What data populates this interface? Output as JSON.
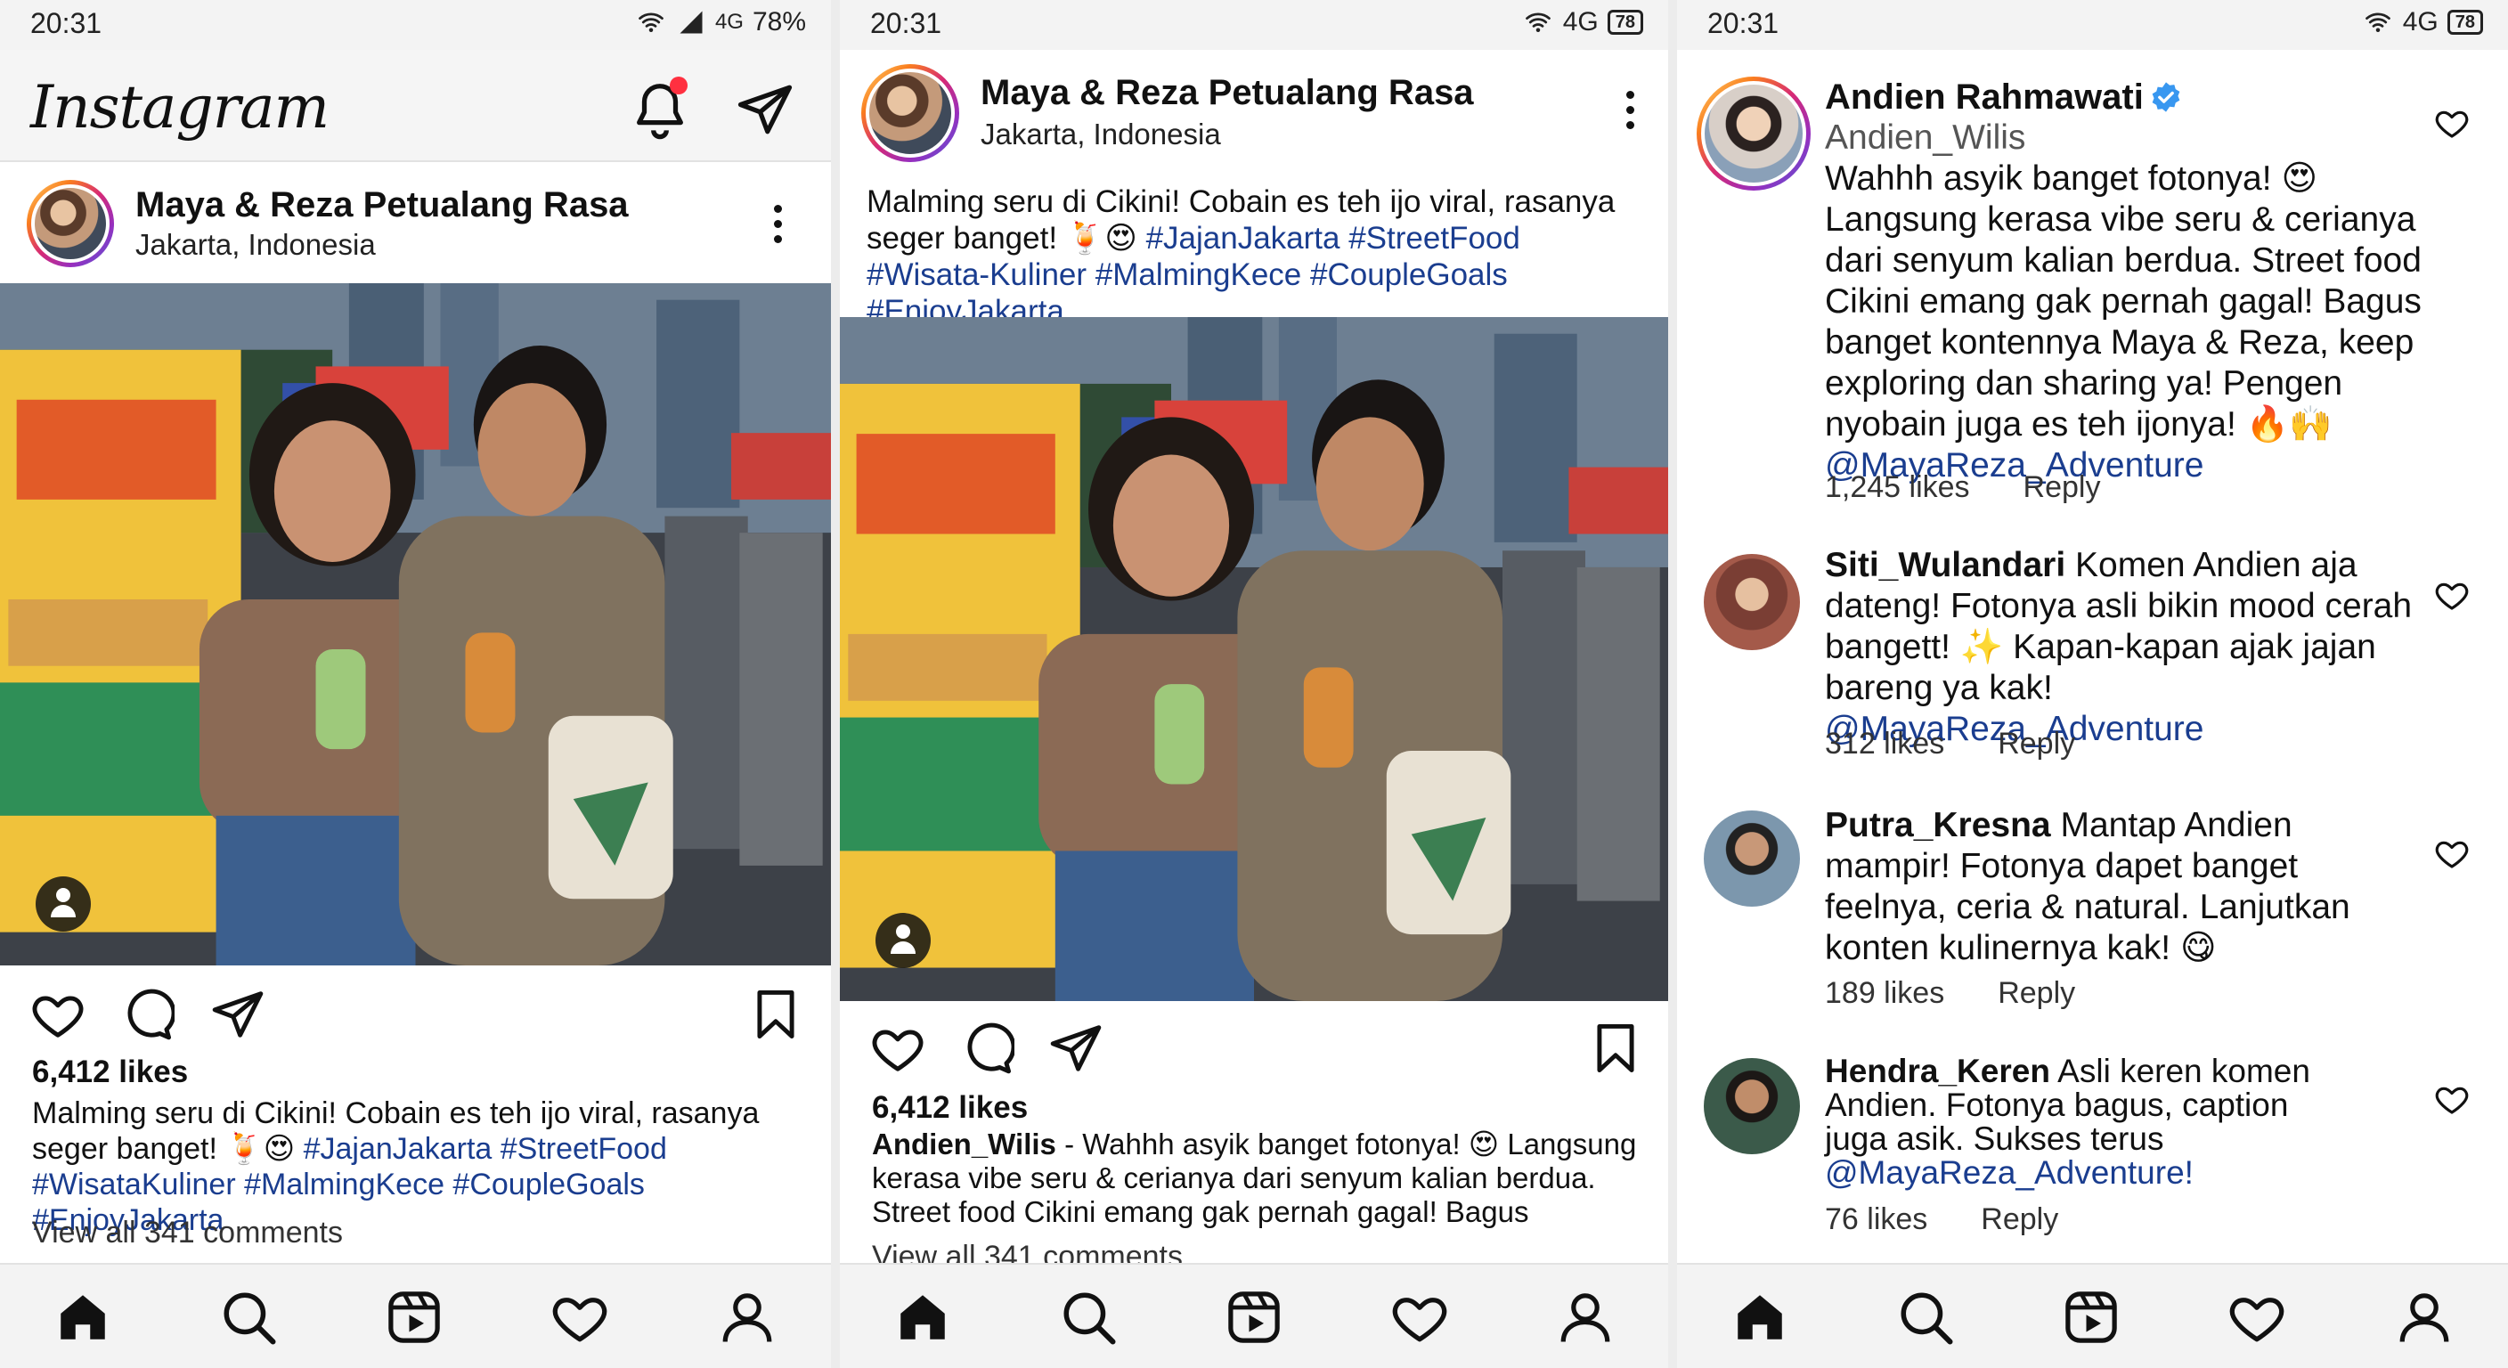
{
  "colors": {
    "accent_link": "#1a3d8f",
    "notification": "#ff3040",
    "verified": "#3897f0"
  },
  "panel1": {
    "status": {
      "time": "20:31",
      "network": "4G",
      "battery": "78%"
    },
    "app_title": "Instagram",
    "post": {
      "account": "Maya & Reza Petualang Rasa",
      "location": "Jakarta, Indonesia",
      "likes": "6,412 likes",
      "caption_text": "Malming seru di Cikini! Cobain es teh ijo viral, rasanya seger banget! 🍹😍 ",
      "caption_tags": "#JajanJakarta #StreetFood #WisataKuliner #MalmingKece #CoupleGoals #EnjoyJakarta",
      "view_all": "View all 341 comments"
    }
  },
  "panel2": {
    "status": {
      "time": "20:31",
      "network": "4G",
      "battery": "78"
    },
    "post": {
      "account": "Maya & Reza Petualang Rasa",
      "location": "Jakarta, Indonesia",
      "caption_text": "Malming seru di Cikini! Cobain es teh ijo viral, rasanya seger banget! 🍹😍 ",
      "caption_tags": "#JajanJakarta #StreetFood #Wisata-Kuliner #MalmingKece #CoupleGoals #EnjoyJakarta",
      "likes": "6,412 likes",
      "comment_user": "Andien_Wilis",
      "comment_text": " - Wahhh asyik banget fotonya! 😍 Langsung kerasa vibe seru & cerianya dari senyum kalian berdua. Street food Cikini emang gak pernah gagal! Bagus",
      "view_all": "View all 341 comments"
    }
  },
  "panel3": {
    "status": {
      "time": "20:31",
      "network": "4G",
      "battery": "78"
    },
    "comments": [
      {
        "name": "Andien Rahmawati",
        "handle": "Andien_Wilis",
        "text": "Wahhh asyik banget fotonya! 😍 Langsung kerasa vibe seru & cerianya dari senyum kalian berdua. Street food Cikini emang gak pernah gagal! Bagus banget kontennya Maya & Reza, keep exploring dan sharing ya! Pengen nyobain juga es teh ijonya! 🔥🙌",
        "mention": "@MayaReza_Adventure",
        "likes": "1,245 likes",
        "reply": "Reply"
      },
      {
        "name": "Siti_Wulandari",
        "text": " Komen Andien aja dateng! Fotonya asli bikin mood cerah bangett! ✨ Kapan-kapan ajak jajan bareng ya kak!",
        "mention": "@MayaReza_Adventure",
        "likes": "312 likes",
        "reply": "Reply"
      },
      {
        "name": "Putra_Kresna",
        "text": " Mantap Andien mampir! Fotonya dapet banget feelnya, ceria & natural. Lanjutkan konten kulinernya kak! 😋",
        "likes": "189 likes",
        "reply": "Reply"
      },
      {
        "name": "Hendra_Keren",
        "text": " Asli keren komen Andien. Fotonya bagus, caption juga asik. Sukses terus",
        "mention": "@MayaReza_Adventure!",
        "likes": "76 likes",
        "reply": "Reply"
      }
    ]
  },
  "icons": [
    "heart-icon",
    "comment-icon",
    "share-icon",
    "bookmark-icon",
    "home-icon",
    "search-icon",
    "reels-icon",
    "activity-icon",
    "profile-icon",
    "notification-icon",
    "direct-message-icon",
    "more-icon",
    "verified-icon",
    "tag-people-icon"
  ]
}
